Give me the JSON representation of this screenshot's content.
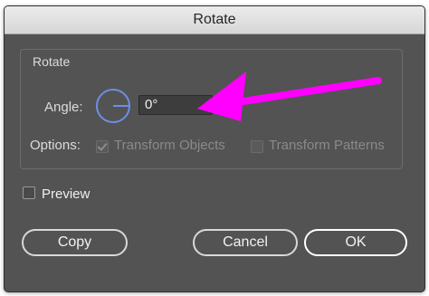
{
  "dialog": {
    "title": "Rotate",
    "group_label": "Rotate",
    "angle_label": "Angle:",
    "angle_value": "0°",
    "options_label": "Options:",
    "transform_objects_label": "Transform Objects",
    "transform_objects_checked": true,
    "transform_patterns_label": "Transform Patterns",
    "transform_patterns_checked": false,
    "preview_label": "Preview",
    "preview_checked": false
  },
  "buttons": {
    "copy": "Copy",
    "cancel": "Cancel",
    "ok": "OK"
  },
  "colors": {
    "dialog_bg": "#535353",
    "dial_color": "#6c8fe6",
    "annotation_arrow": "#ff00ff"
  },
  "icons": {
    "dial": "angle-dial-icon",
    "annotation": "arrow-annotation-icon"
  }
}
